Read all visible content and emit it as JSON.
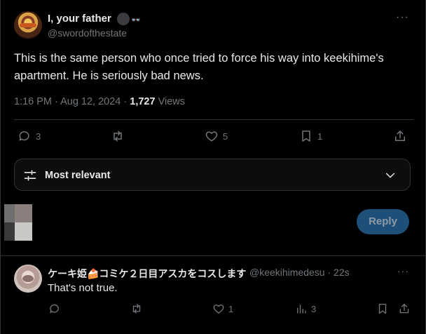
{
  "tweet": {
    "display_name": "I, your father",
    "badge_emoji": "👓",
    "handle": "@swordofthestate",
    "more": "···",
    "text": "This is the same person who once tried to force his way into keekihime's apartment. He is seriously bad news.",
    "time": "1:16 PM · Aug 12, 2024 · ",
    "views_count": "1,727",
    "views_label": " Views",
    "actions": {
      "replies": "3",
      "retweets": "",
      "likes": "5",
      "bookmarks": "1"
    }
  },
  "sort": {
    "label": "Most relevant"
  },
  "composer": {
    "reply_label": "Reply"
  },
  "reply": {
    "display_name": "ケーキ姫🍰コミケ２日目アスカをコスします",
    "handle": "@keekihimedesu · 22s",
    "more": "···",
    "text": "That's not true.",
    "actions": {
      "replies": "",
      "retweets": "",
      "likes": "1",
      "views": "3"
    }
  },
  "colors": {
    "background": "#000000",
    "text": "#e7e9ea",
    "muted": "#71767b",
    "border": "#2f3336",
    "reply_button": "#1d4f79"
  }
}
